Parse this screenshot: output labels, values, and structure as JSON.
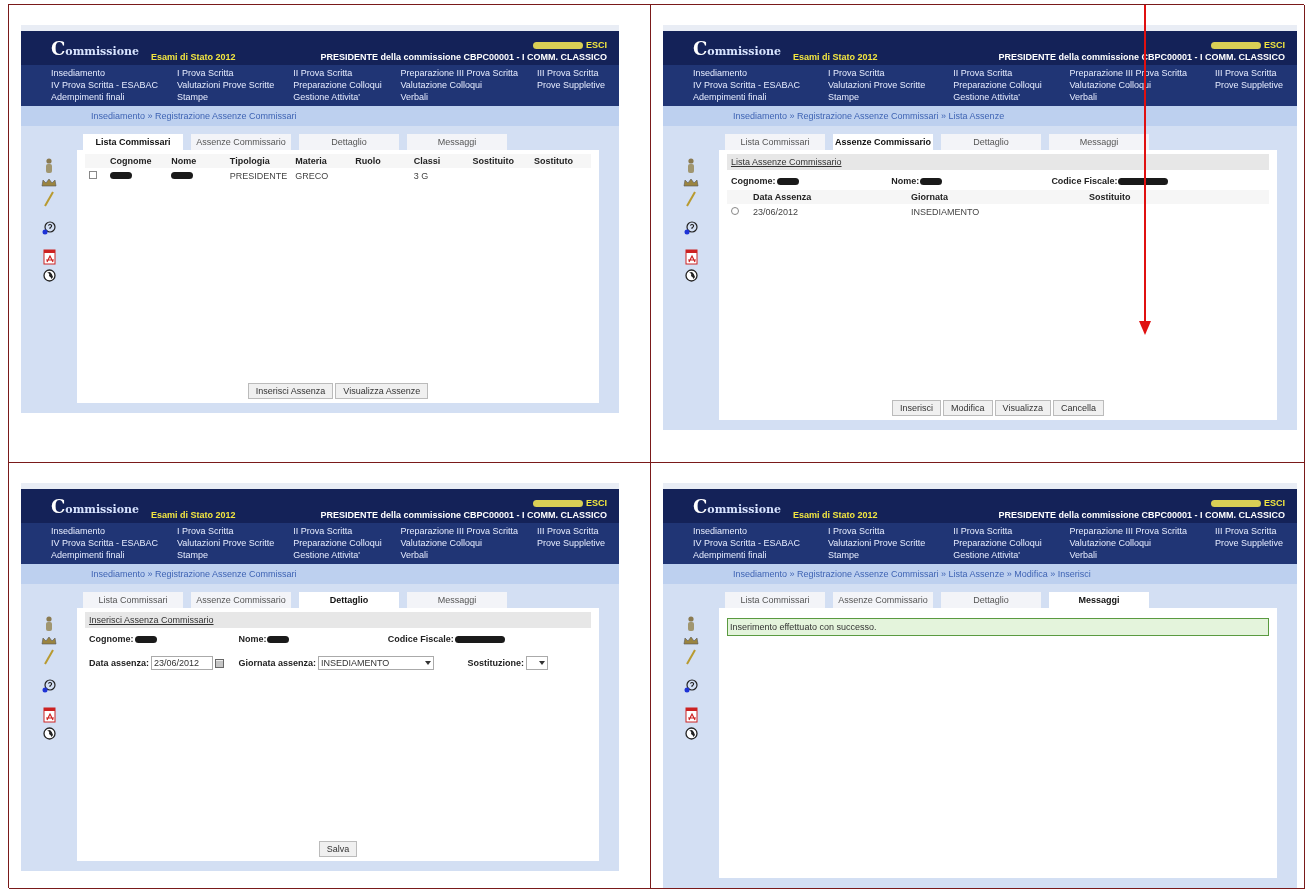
{
  "panels": [
    {
      "kind": "list",
      "arrow": false,
      "header": {
        "logo": "Commissione",
        "year": "Esami di Stato 2012",
        "logout": "ESCI",
        "role": "PRESIDENTE della commissione CBPC00001 - I COMM. CLASSICO"
      },
      "menu": [
        "Insediamento",
        "I Prova Scritta",
        "II Prova Scritta",
        "Preparazione III Prova Scritta",
        "III Prova Scritta",
        "IV Prova Scritta - ESABAC",
        "Valutazioni Prove Scritte",
        "Preparazione Colloqui",
        "Valutazione Colloqui",
        "Prove Suppletive",
        "Adempimenti finali",
        "Stampe",
        "Gestione Attivita'",
        "Verbali"
      ],
      "breadcrumb": "Insediamento » Registrazione Assenze Commissari",
      "tabs": [
        {
          "label": "Lista Commissari",
          "selected": true
        },
        {
          "label": "Assenze Commissario",
          "selected": false
        },
        {
          "label": "Dettaglio",
          "selected": false
        },
        {
          "label": "Messaggi",
          "selected": false
        }
      ],
      "table": {
        "columns": [
          "Cognome",
          "Nome",
          "Tipologia",
          "Materia",
          "Ruolo",
          "Classi",
          "Sostituito",
          "Sostituto"
        ],
        "rows": [
          {
            "kind": "checkbox",
            "checked": false,
            "cells": [
              {
                "kind": "redacted"
              },
              {
                "kind": "redacted"
              },
              {
                "kind": "text",
                "text": "PRESIDENTE"
              },
              {
                "kind": "text",
                "text": "GRECO"
              },
              {
                "kind": "empty"
              },
              {
                "kind": "text",
                "text": "3 G"
              },
              {
                "kind": "empty"
              },
              {
                "kind": "empty"
              }
            ]
          }
        ]
      },
      "buttons": [
        "Inserisci Assenza",
        "Visualizza Assenze"
      ]
    },
    {
      "kind": "absences",
      "arrow": true,
      "header": {
        "logo": "Commissione",
        "year": "Esami di Stato 2012",
        "logout": "ESCI",
        "role": "PRESIDENTE della commissione CBPC00001 - I COMM. CLASSICO"
      },
      "menu": [
        "Insediamento",
        "I Prova Scritta",
        "II Prova Scritta",
        "Preparazione III Prova Scritta",
        "III Prova Scritta",
        "IV Prova Scritta - ESABAC",
        "Valutazioni Prove Scritte",
        "Preparazione Colloqui",
        "Valutazione Colloqui",
        "Prove Suppletive",
        "Adempimenti finali",
        "Stampe",
        "Gestione Attivita'",
        "Verbali"
      ],
      "breadcrumb": "Insediamento » Registrazione Assenze Commissari » Lista Assenze",
      "tabs": [
        {
          "label": "Lista Commissari",
          "selected": false
        },
        {
          "label": "Assenze Commissario",
          "selected": true
        },
        {
          "label": "Dettaglio",
          "selected": false
        },
        {
          "label": "Messaggi",
          "selected": false
        }
      ],
      "section": "Lista Assenze Commissario",
      "fields": [
        {
          "label": "Cognome:"
        },
        {
          "label": "Nome:"
        },
        {
          "label": "Codice Fiscale:"
        }
      ],
      "table": {
        "columns": [
          "Data Assenza",
          "Giornata",
          "Sostituito"
        ],
        "rows": [
          {
            "kind": "radio",
            "selected": false,
            "cells": [
              {
                "kind": "text",
                "text": "23/06/2012"
              },
              {
                "kind": "text",
                "text": "INSEDIAMENTO"
              },
              {
                "kind": "empty"
              }
            ]
          }
        ]
      },
      "buttons": [
        "Inserisci",
        "Modifica",
        "Visualizza",
        "Cancella"
      ]
    },
    {
      "kind": "form",
      "arrow": false,
      "header": {
        "logo": "Commissione",
        "year": "Esami di Stato 2012",
        "logout": "ESCI",
        "role": "PRESIDENTE della commissione CBPC00001 - I COMM. CLASSICO"
      },
      "menu": [
        "Insediamento",
        "I Prova Scritta",
        "II Prova Scritta",
        "Preparazione III Prova Scritta",
        "III Prova Scritta",
        "IV Prova Scritta - ESABAC",
        "Valutazioni Prove Scritte",
        "Preparazione Colloqui",
        "Valutazione Colloqui",
        "Prove Suppletive",
        "Adempimenti finali",
        "Stampe",
        "Gestione Attivita'",
        "Verbali"
      ],
      "breadcrumb": "Insediamento » Registrazione Assenze Commissari",
      "tabs": [
        {
          "label": "Lista Commissari",
          "selected": false
        },
        {
          "label": "Assenze Commissario",
          "selected": false
        },
        {
          "label": "Dettaglio",
          "selected": true
        },
        {
          "label": "Messaggi",
          "selected": false
        }
      ],
      "section": "Inserisci Assenza Commissario",
      "fields": [
        {
          "label": "Cognome:"
        },
        {
          "label": "Nome:"
        },
        {
          "label": "Codice Fiscale:"
        }
      ],
      "form": [
        {
          "kind": "date",
          "label": "Data assenza:",
          "value": "23/06/2012"
        },
        {
          "kind": "select",
          "label": "Giornata assenza:",
          "value": "INSEDIAMENTO"
        },
        {
          "kind": "select",
          "label": "Sostituzione:"
        }
      ],
      "buttons": [
        "Salva"
      ]
    },
    {
      "kind": "message",
      "arrow": false,
      "header": {
        "logo": "Commissione",
        "year": "Esami di Stato 2012",
        "logout": "ESCI",
        "role": "PRESIDENTE della commissione CBPC00001 - I COMM. CLASSICO"
      },
      "menu": [
        "Insediamento",
        "I Prova Scritta",
        "II Prova Scritta",
        "Preparazione III Prova Scritta",
        "III Prova Scritta",
        "IV Prova Scritta - ESABAC",
        "Valutazioni Prove Scritte",
        "Preparazione Colloqui",
        "Valutazione Colloqui",
        "Prove Suppletive",
        "Adempimenti finali",
        "Stampe",
        "Gestione Attivita'",
        "Verbali"
      ],
      "breadcrumb": "Insediamento » Registrazione Assenze Commissari » Lista Assenze » Modifica » Inserisci",
      "tabs": [
        {
          "label": "Lista Commissari",
          "selected": false
        },
        {
          "label": "Assenze Commissario",
          "selected": false
        },
        {
          "label": "Dettaglio",
          "selected": false
        },
        {
          "label": "Messaggi",
          "selected": true
        }
      ],
      "message": "Inserimento effettuato con successo."
    }
  ]
}
